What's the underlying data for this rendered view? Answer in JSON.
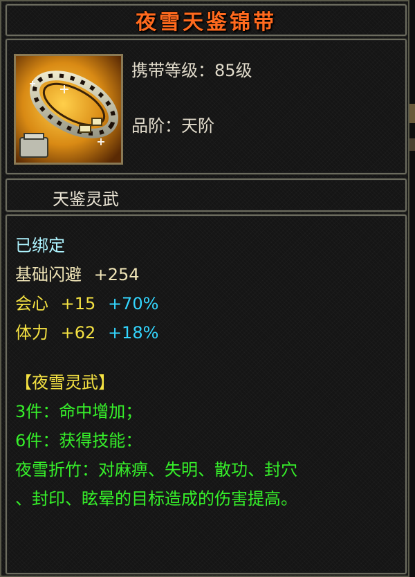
{
  "item": {
    "name": "夜雪天鉴锦带",
    "requirement": "携带等级：85级",
    "tier": "品阶：天阶",
    "set_title": "天鉴灵武",
    "icon": "golden-belt-icon"
  },
  "stats": {
    "bound": "已绑定",
    "base_dodge": {
      "label": "基础闪避",
      "value": "+254"
    },
    "crit": {
      "label": "会心",
      "value": "+15",
      "percent": "+70%"
    },
    "stamina": {
      "label": "体力",
      "value": "+62",
      "percent": "+18%"
    }
  },
  "set_bonus": {
    "name": "【夜雪灵武】",
    "bonus_3": "3件：命中增加；",
    "bonus_6": "6件：获得技能：",
    "skill_line1": "夜雪折竹：对麻痹、失明、散功、封穴",
    "skill_line2": "、封印、眩晕的目标造成的伤害提高。"
  },
  "colors": {
    "title": "#ff6a1e",
    "bound": "#aef4ff",
    "yellow": "#f5e242",
    "cyan": "#33d6ff",
    "green": "#36f02a"
  }
}
